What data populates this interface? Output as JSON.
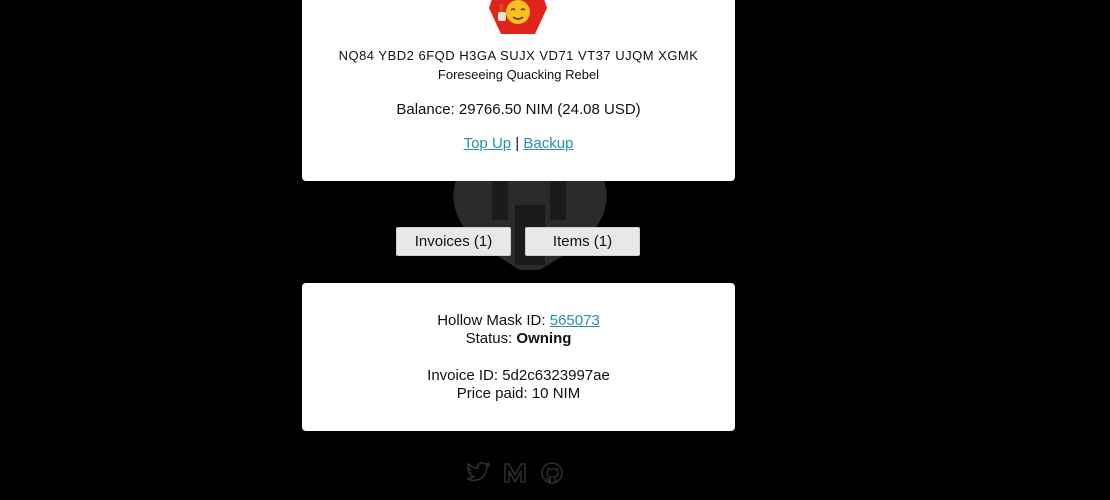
{
  "wallet": {
    "address": "NQ84 YBD2 6FQD H3GA SUJX VD71 VT37 UJQM XGMK",
    "name": "Foreseeing Quacking Rebel",
    "balance_label": "Balance: ",
    "balance_value": "29766.50 NIM (24.08 USD)",
    "top_up_label": "Top Up",
    "separator": " | ",
    "backup_label": "Backup"
  },
  "tabs": {
    "invoices_label": "Invoices (1)",
    "items_label": "Items (1)"
  },
  "item": {
    "mask_label": "Hollow Mask ID: ",
    "mask_id": "565073",
    "status_label": "Status: ",
    "status_value": "Owning",
    "invoice_label": "Invoice ID: ",
    "invoice_id": "5d2c6323997ae",
    "price_label": "Price paid: ",
    "price_value": "10 NIM"
  },
  "icons": {
    "social": [
      "twitter-icon",
      "medium-icon",
      "github-icon"
    ],
    "background": "hollow-mask-icon",
    "avatar": "nimiqon-avatar-icon"
  },
  "colors": {
    "background": "#000000",
    "card": "#ffffff",
    "link": "#2a8fb0",
    "avatar_hex": "#e0241c",
    "avatar_face": "#f7c21e",
    "social_icon": "#2e2e2e"
  }
}
